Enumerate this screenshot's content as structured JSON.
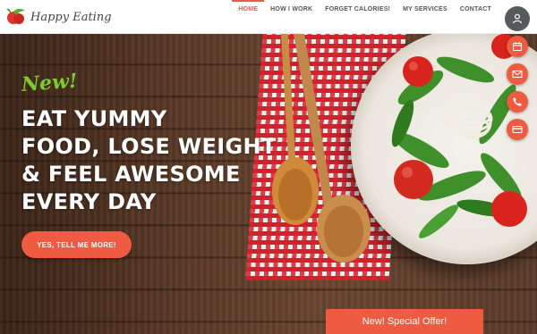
{
  "brand": {
    "name": "Happy Eating"
  },
  "nav": {
    "items": [
      {
        "label": "HOME",
        "active": true
      },
      {
        "label": "HOW I WORK"
      },
      {
        "label": "FORGET CALORIES!"
      },
      {
        "label": "MY SERVICES"
      },
      {
        "label": "CONTACT"
      }
    ]
  },
  "hero": {
    "tag": "New!",
    "headline": [
      "EAT YUMMY",
      "FOOD, LOSE WEIGHT",
      "& FEEL AWESOME",
      "EVERY DAY"
    ],
    "cta_label": "YES, TELL ME MORE!",
    "offer_label": "New! Special Offer!"
  },
  "side_actions": [
    {
      "icon": "calendar-icon"
    },
    {
      "icon": "envelope-icon"
    },
    {
      "icon": "phone-icon"
    },
    {
      "icon": "credit-card-icon"
    }
  ],
  "colors": {
    "accent": "#ee5b40",
    "tag_green": "#7ccd2b",
    "user_button": "#555a5c"
  }
}
